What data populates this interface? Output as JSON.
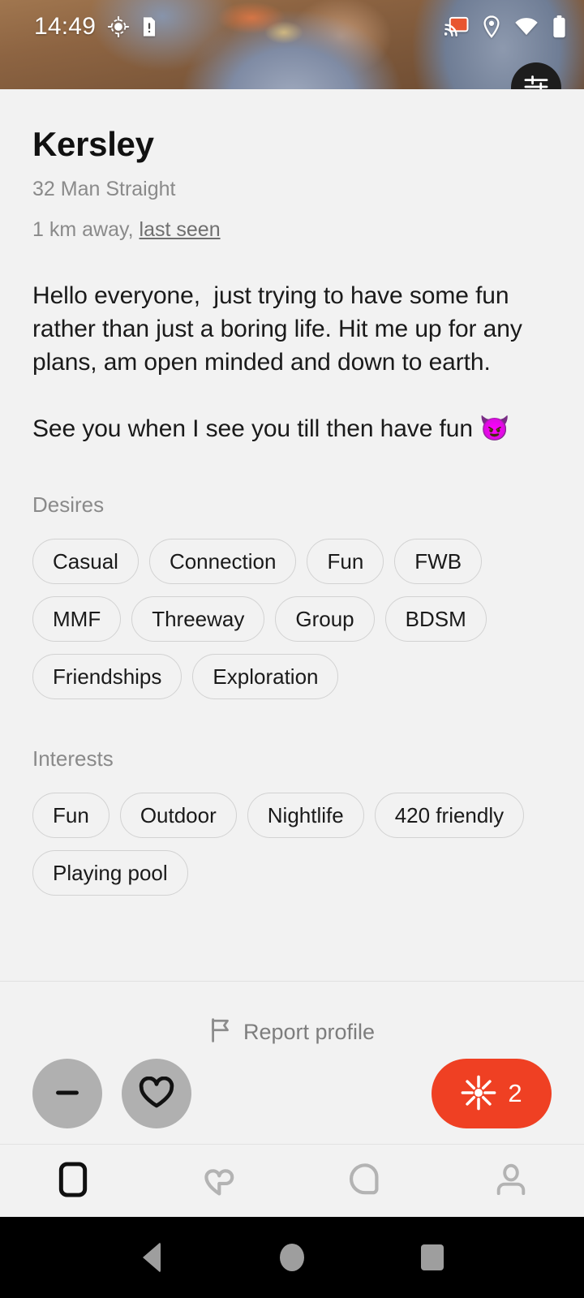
{
  "status_bar": {
    "time": "14:49",
    "icons": [
      "gps-crosshair-icon",
      "sim-alert-icon",
      "cast-icon",
      "location-pin-icon",
      "wifi-icon",
      "battery-icon"
    ],
    "cast_accent_color": "#e8552f"
  },
  "header": {
    "filter_button": "filter-sliders-icon"
  },
  "profile": {
    "name": "Kersley",
    "age_gender": "32 Man Straight",
    "distance": "1 km away,",
    "last_seen_label": "last seen",
    "bio": "Hello everyone,  just trying to have some fun rather than just a boring life. Hit me up for any plans, am open minded and down to earth.\n\nSee you when I see you till then have fun ",
    "bio_emoji": "😈"
  },
  "desires": {
    "title": "Desires",
    "chips": [
      "Casual",
      "Connection",
      "Fun",
      "FWB",
      "MMF",
      "Threeway",
      "Group",
      "BDSM",
      "Friendships",
      "Exploration"
    ]
  },
  "interests": {
    "title": "Interests",
    "chips": [
      "Fun",
      "Outdoor",
      "Nightlife",
      "420 friendly",
      "Playing pool"
    ]
  },
  "actions": {
    "report_label": "Report profile",
    "report_icon": "flag-icon",
    "pass_icon": "minus-icon",
    "like_icon": "heart-outline-icon",
    "boost_icon": "sparkle-icon",
    "boost_count": "2",
    "boost_color": "#ef4023",
    "circle_button_color": "#b0b0b0"
  },
  "bottom_nav": {
    "items": [
      {
        "name": "cards-icon",
        "active": true
      },
      {
        "name": "heart-icon",
        "active": false
      },
      {
        "name": "chat-bubble-icon",
        "active": false
      },
      {
        "name": "profile-person-icon",
        "active": false
      }
    ]
  },
  "system_nav": {
    "back": "back-triangle-icon",
    "home": "home-circle-icon",
    "recents": "recents-square-icon"
  }
}
